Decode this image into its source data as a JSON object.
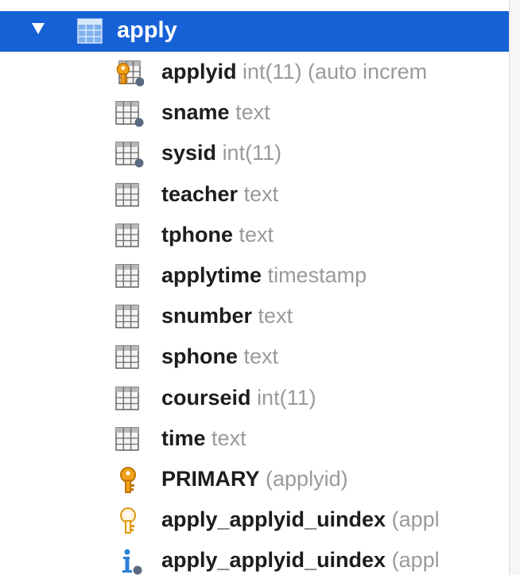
{
  "table": {
    "name": "apply",
    "expanded": true,
    "highlight_color": "#1661d6",
    "icon": "table-icon"
  },
  "rows": [
    {
      "name": "applyid",
      "detail": "int(11) (auto increm",
      "icon": "primary-key-column-icon"
    },
    {
      "name": "sname",
      "detail": "text",
      "icon": "indexed-column-icon"
    },
    {
      "name": "sysid",
      "detail": "int(11)",
      "icon": "indexed-column-icon"
    },
    {
      "name": "teacher",
      "detail": "text",
      "icon": "column-icon"
    },
    {
      "name": "tphone",
      "detail": "text",
      "icon": "column-icon"
    },
    {
      "name": "applytime",
      "detail": "timestamp",
      "icon": "column-icon"
    },
    {
      "name": "snumber",
      "detail": "text",
      "icon": "column-icon"
    },
    {
      "name": "sphone",
      "detail": "text",
      "icon": "column-icon"
    },
    {
      "name": "courseid",
      "detail": "int(11)",
      "icon": "column-icon"
    },
    {
      "name": "time",
      "detail": "text",
      "icon": "column-icon"
    },
    {
      "name": "PRIMARY",
      "detail": "(applyid)",
      "icon": "primary-key-icon"
    },
    {
      "name": "apply_applyid_uindex",
      "detail": "(appl",
      "icon": "unique-key-icon"
    },
    {
      "name": "apply_applyid_uindex",
      "detail": "(appl",
      "icon": "index-info-icon"
    }
  ]
}
